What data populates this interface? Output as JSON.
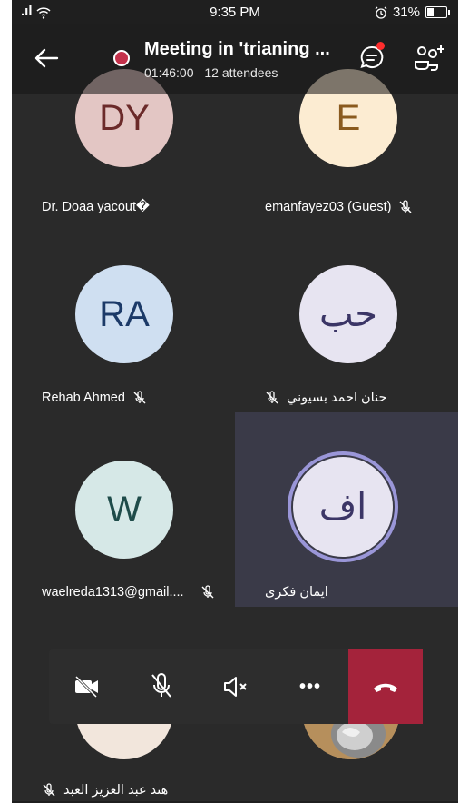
{
  "status_bar": {
    "signal": ".ıl",
    "time": "9:35 PM",
    "battery": "31%"
  },
  "header": {
    "title": "Meeting in 'trianing ...",
    "duration": "01:46:00",
    "attendees": "12 attendees"
  },
  "participants": [
    {
      "initials": "DY",
      "name": "Dr. Doaa yacout�",
      "muted": false,
      "bg": "#e3c6c4",
      "fg": "#6b2a2a"
    },
    {
      "initials": "E",
      "name": "emanfayez03 (Guest)",
      "muted": true,
      "bg": "#fcecd2",
      "fg": "#8a5a1e"
    },
    {
      "initials": "RA",
      "name": "Rehab Ahmed",
      "muted": true,
      "bg": "#cfdff1",
      "fg": "#1c3a68"
    },
    {
      "initials": "حب",
      "name": "حنان احمد بسيوني",
      "muted": true,
      "bg": "#e7e4f1",
      "fg": "#3b3566"
    },
    {
      "initials": "W",
      "name": "waelreda1313@gmail....",
      "muted": true,
      "bg": "#d6e8e7",
      "fg": "#1f4c4a"
    },
    {
      "initials": "اف",
      "name": "ايمان فكرى",
      "muted": false,
      "bg": "#e7e4f1",
      "fg": "#3b3566"
    },
    {
      "initials": "",
      "name": "هند عبد العزيز العبد",
      "muted": true,
      "bg": "#f2e6dc",
      "fg": "#6b4a2a"
    },
    {
      "initials": "",
      "name": "",
      "muted": false,
      "bg": "#c9a77a",
      "fg": "#3a2a10"
    }
  ],
  "controls": {
    "camera": "camera-off-icon",
    "mic": "mic-off-icon",
    "speaker": "speaker-off-icon",
    "more": "•••",
    "hangup": "hang-up-icon"
  }
}
